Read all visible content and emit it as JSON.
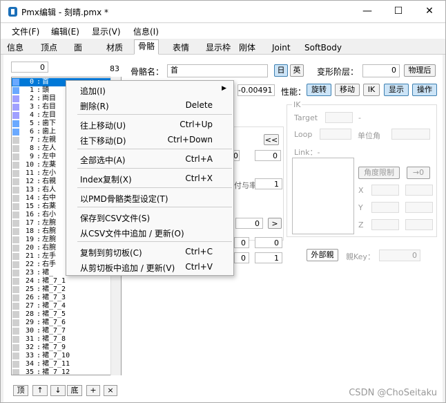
{
  "window": {
    "title": "Pmx编辑 - 刻晴.pmx *",
    "min": "—",
    "max": "☐",
    "close": "✕"
  },
  "menu": [
    "文件(F)",
    "编辑(E)",
    "显示(V)",
    "信息(I)"
  ],
  "tabs": [
    "信息",
    "顶点",
    "面",
    "材质",
    "骨骼",
    "表情",
    "显示枠",
    "刚体",
    "Joint",
    "SoftBody"
  ],
  "left": {
    "search_value": "0",
    "count": "83"
  },
  "bone_list": [
    {
      "n": "0",
      "name": "首",
      "c": "#6aa9ff"
    },
    {
      "n": "1",
      "name": "頭",
      "c": "#6aa9ff"
    },
    {
      "n": "2",
      "name": "両目",
      "c": "#a0a0ff"
    },
    {
      "n": "3",
      "name": "右目",
      "c": "#a0a0ff"
    },
    {
      "n": "4",
      "name": "左目",
      "c": "#a0a0ff"
    },
    {
      "n": "5",
      "name": "歯下",
      "c": "#6aa9ff"
    },
    {
      "n": "6",
      "name": "歯上",
      "c": "#6aa9ff"
    },
    {
      "n": "7",
      "name": "左親",
      "c": "#cfcfcf"
    },
    {
      "n": "8",
      "name": "左人",
      "c": "#cfcfcf"
    },
    {
      "n": "9",
      "name": "左中",
      "c": "#cfcfcf"
    },
    {
      "n": "10",
      "name": "左薬",
      "c": "#cfcfcf"
    },
    {
      "n": "11",
      "name": "左小",
      "c": "#cfcfcf"
    },
    {
      "n": "12",
      "name": "右親",
      "c": "#cfcfcf"
    },
    {
      "n": "13",
      "name": "右人",
      "c": "#cfcfcf"
    },
    {
      "n": "14",
      "name": "右中",
      "c": "#cfcfcf"
    },
    {
      "n": "15",
      "name": "右薬",
      "c": "#cfcfcf"
    },
    {
      "n": "16",
      "name": "右小",
      "c": "#cfcfcf"
    },
    {
      "n": "17",
      "name": "左腕",
      "c": "#cfcfcf"
    },
    {
      "n": "18",
      "name": "右腕",
      "c": "#cfcfcf"
    },
    {
      "n": "19",
      "name": "左腕",
      "c": "#cfcfcf"
    },
    {
      "n": "20",
      "name": "右腕",
      "c": "#cfcfcf"
    },
    {
      "n": "21",
      "name": "左手",
      "c": "#cfcfcf"
    },
    {
      "n": "22",
      "name": "右手",
      "c": "#cfcfcf"
    },
    {
      "n": "23",
      "name": "裙_",
      "c": "#cfcfcf"
    },
    {
      "n": "24",
      "name": "裙_7_1",
      "c": "#cfcfcf"
    },
    {
      "n": "25",
      "name": "裙_7_2",
      "c": "#cfcfcf"
    },
    {
      "n": "26",
      "name": "裙_7_3",
      "c": "#cfcfcf"
    },
    {
      "n": "27",
      "name": "裙_7_4",
      "c": "#cfcfcf"
    },
    {
      "n": "28",
      "name": "裙_7_5",
      "c": "#cfcfcf"
    },
    {
      "n": "29",
      "name": "裙_7_6",
      "c": "#cfcfcf"
    },
    {
      "n": "30",
      "name": "裙_7_7",
      "c": "#cfcfcf"
    },
    {
      "n": "31",
      "name": "裙_7_8",
      "c": "#cfcfcf"
    },
    {
      "n": "32",
      "name": "裙_7_9",
      "c": "#cfcfcf"
    },
    {
      "n": "33",
      "name": "裙_7_10",
      "c": "#cfcfcf"
    },
    {
      "n": "34",
      "name": "裙_7_11",
      "c": "#cfcfcf"
    },
    {
      "n": "35",
      "name": "裙_7_12",
      "c": "#cfcfcf"
    }
  ],
  "list_buttons": [
    "顶",
    "↑",
    "↓",
    "底",
    "+",
    "×"
  ],
  "bone": {
    "name_label": "骨骼名：",
    "name_value": "首",
    "jp": "日",
    "en": "英",
    "deform_label": "变形阶层：",
    "deform_value": "0",
    "after_physics": "物理后",
    "num_value": "-0.00491",
    "perf_label": "性能：",
    "rotate": "旋转",
    "move": "移动",
    "ik": "IK",
    "show": "显示",
    "operate": "操作"
  },
  "left_group": {
    "back": "<<",
    "v1": "0",
    "v2": "0",
    "rate_label": "付与率",
    "rate_value": "1",
    "v3": "0",
    "next": ">",
    "a": "0",
    "b": "0",
    "c": "0",
    "d": "1"
  },
  "ik": {
    "title": "IK",
    "target": "Target",
    "target_dash": "-",
    "loop": "Loop",
    "unit": "单位角",
    "link": "Link：-",
    "angle_limit": "角度限制",
    "to0": "→0",
    "x": "X",
    "y": "Y",
    "z": "Z"
  },
  "outer": {
    "btn": "外部親",
    "key_label": "親Key：",
    "key_value": "0"
  },
  "context_menu": [
    {
      "label": "追加(I)",
      "sc": "",
      "arrow": "▶"
    },
    {
      "label": "删除(R)",
      "sc": "Delete"
    },
    {
      "label": "往上移动(U)",
      "sc": "Ctrl+Up"
    },
    {
      "label": "往下移动(D)",
      "sc": "Ctrl+Down"
    },
    {
      "label": "全部选中(A)",
      "sc": "Ctrl+A"
    },
    {
      "label": "Index复制(X)",
      "sc": "Ctrl+X"
    },
    {
      "label": "以PMD骨骼类型设定(T)",
      "sc": ""
    },
    {
      "label": "保存到CSV文件(S)",
      "sc": ""
    },
    {
      "label": "从CSV文件中追加 / 更新(O)",
      "sc": ""
    },
    {
      "label": "复制到剪切板(C)",
      "sc": "Ctrl+C"
    },
    {
      "label": "从剪切板中追加 / 更新(V)",
      "sc": "Ctrl+V"
    }
  ],
  "watermark": "CSDN @ChoSeitaku"
}
